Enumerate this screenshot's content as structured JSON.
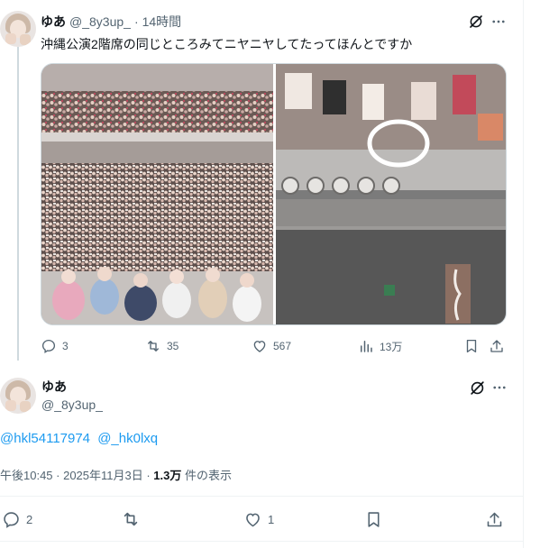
{
  "tweet": {
    "display_name": "ゆあ",
    "handle": "@_8y3up_",
    "separator": "·",
    "time_ago": "14時間",
    "text": "沖縄公演2階席の同じところみてニヤニヤしてたってほんとですか",
    "media": [
      {
        "kind": "photo",
        "subject": "concert hall audience group photo with performers in front row"
      },
      {
        "kind": "photo",
        "subject": "zoomed balcony seats with a white circle drawn around two people"
      }
    ],
    "actions": {
      "reply_count": "3",
      "retweet_count": "35",
      "like_count": "567",
      "view_count": "13万"
    }
  },
  "reply": {
    "display_name": "ゆあ",
    "handle": "@_8y3up_",
    "mentions": [
      "@hkl54117974",
      "@_hk0lxq"
    ],
    "meta_prefix": "午後10:45 · 2025年11月3日 · ",
    "meta_views": "1.3万",
    "meta_suffix": " 件の表示",
    "actions": {
      "reply_count": "2",
      "like_count": "1"
    }
  },
  "colors": {
    "accent_blue": "#1d9bf0",
    "text_primary": "#0f1419",
    "text_secondary": "#536471",
    "border": "#cfd9de",
    "circle_annotation": "#ffffff"
  },
  "icons": [
    "grok-icon",
    "more-icon",
    "reply-icon",
    "retweet-icon",
    "like-icon",
    "views-icon",
    "bookmark-icon",
    "share-icon"
  ]
}
